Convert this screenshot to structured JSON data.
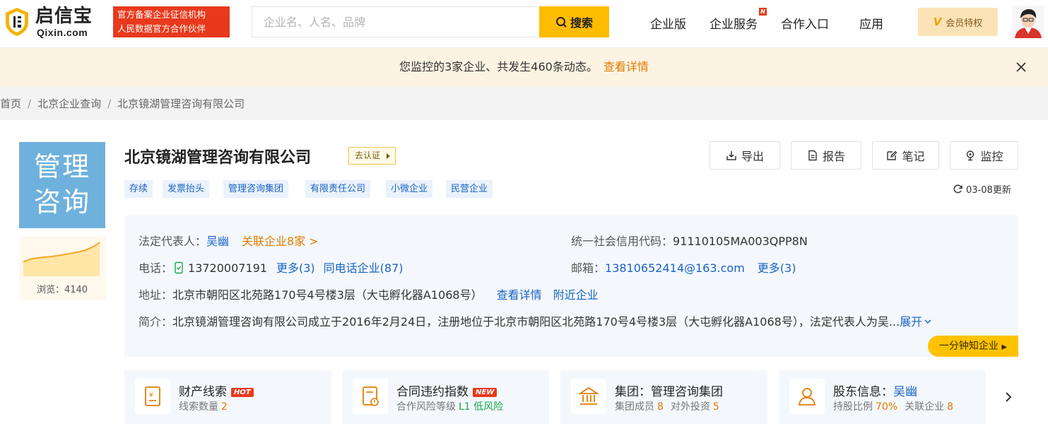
{
  "header": {
    "logo_main": "启信宝",
    "logo_sub": "Qixin.com",
    "gov_badge_line1": "官方备案企业征信机构",
    "gov_badge_line2": "人民数据官方合作伙伴",
    "search_placeholder": "企业名、人名、品牌",
    "search_button": "搜索",
    "nav": [
      "企业版",
      "企业服务",
      "合作入口",
      "应用"
    ],
    "nav_new_badge": "N",
    "vip_mark": "V",
    "vip_label": "会员特权"
  },
  "banner": {
    "text": "您监控的3家企业、共发生460条动态。",
    "link": "查看详情"
  },
  "breadcrumb": [
    "首页",
    "北京企业查询",
    "北京镜湖管理咨询有限公司"
  ],
  "company": {
    "logo_text_line1": "管理",
    "logo_text_line2": "咨询",
    "views_label": "浏览：4140",
    "name": "北京镜湖管理咨询有限公司",
    "cert": "去认证",
    "tags": [
      "存续",
      "发票抬头",
      "管理咨询集团",
      "有限责任公司",
      "小微企业",
      "民营企业"
    ],
    "actions": [
      "导出",
      "报告",
      "笔记",
      "监控"
    ],
    "updated": "03-08更新"
  },
  "info": {
    "legal_label": "法定代表人：",
    "legal_name": "吴幽",
    "related": "关联企业8家 >",
    "credit_label": "统一社会信用代码：",
    "credit_code": "91110105MA003QPP8N",
    "phone_label": "电话：",
    "phone": "13720007191",
    "phone_more": "更多(3)",
    "same_phone": "同电话企业(87)",
    "email_label": "邮箱：",
    "email": "13810652414@163.com",
    "email_more": "更多(3)",
    "address_label": "地址：",
    "address": "北京市朝阳区北苑路170号4号楼3层（大屯孵化器A1068号）",
    "address_detail": "查看详情",
    "nearby": "附近企业",
    "intro_label": "简介：",
    "intro": "北京镜湖管理咨询有限公司成立于2016年2月24日，注册地位于北京市朝阳区北苑路170号4号楼3层（大屯孵化器A1068号），法定代表人为吴...",
    "expand": "展开",
    "quick": "一分钟知企业"
  },
  "cards": [
    {
      "title": "财产线索",
      "badge": "HOT",
      "sub1": "线索数量",
      "val1": "2",
      "sub2": "",
      "val2": ""
    },
    {
      "title": "合同违约指数",
      "badge": "NEW",
      "sub1": "合作风险等级",
      "val1": "L1 低风险",
      "sub2": "",
      "val2": ""
    },
    {
      "title": "集团：管理咨询集团",
      "badge": "",
      "sub1": "集团成员",
      "val1": "8",
      "sub2": "对外投资",
      "val2": "5"
    },
    {
      "title_prefix": "股东信息：",
      "title_name": "吴幽",
      "badge": "",
      "sub1": "持股比例",
      "val1": "70%",
      "sub2": "关联企业",
      "val2": "8"
    }
  ],
  "colors": {
    "brand_yellow": "#ffbb00",
    "badge_red": "#e8391c",
    "link_blue": "#1a63c4",
    "accent_orange": "#e07b00",
    "logo_blue": "#6fb1dd"
  }
}
